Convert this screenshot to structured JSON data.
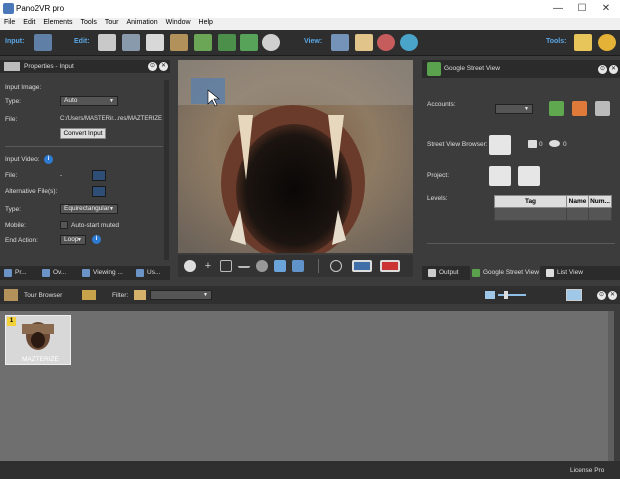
{
  "window": {
    "title": "Pano2VR pro"
  },
  "menu": [
    "File",
    "Edit",
    "Elements",
    "Tools",
    "Tour",
    "Animation",
    "Window",
    "Help"
  ],
  "toolbar": {
    "input_label": "Input:",
    "edit_label": "Edit:",
    "view_label": "View:",
    "tools_label": "Tools:"
  },
  "properties": {
    "title": "Properties - Input",
    "input_image_heading": "Input Image:",
    "type_label": "Type:",
    "type_value": "Auto",
    "file_label": "File:",
    "file_value": "C:/Users/MASTERir...res/MAZTERIZE",
    "convert_button": "Convert Input",
    "input_video_heading": "Input Video:",
    "video_file_label": "File:",
    "video_file_value": "-",
    "alt_files_label": "Alternative File(s):",
    "video_type_label": "Type:",
    "video_type_value": "Equirectangular",
    "mobile_label": "Mobile:",
    "autostart_label": "Auto-start muted",
    "end_action_label": "End Action:",
    "end_action_value": "Loop"
  },
  "left_tabs": [
    "Pr...",
    "Ov...",
    "Viewing ...",
    "Us..."
  ],
  "gsv": {
    "title": "Google Street View",
    "accounts_label": "Accounts:",
    "browser_label": "Street View Browser:",
    "camera_count": "0",
    "eye_count": "0",
    "project_label": "Project:",
    "levels_label": "Levels:",
    "table_headers": [
      "Tag",
      "Name",
      "Num..."
    ]
  },
  "right_tabs": [
    "Output",
    "Google Street View",
    "List View"
  ],
  "tour": {
    "title": "Tour Browser",
    "filter_label": "Filter:",
    "badge": "1",
    "node_label": "MAZTERIZE"
  },
  "status": {
    "license": "License Pro"
  },
  "colors": {
    "accent": "#5aa7e6",
    "panel_bg": "#3c3c3c",
    "dark_bg": "#2b2b2b",
    "tour_bg": "#6f6f6f"
  }
}
